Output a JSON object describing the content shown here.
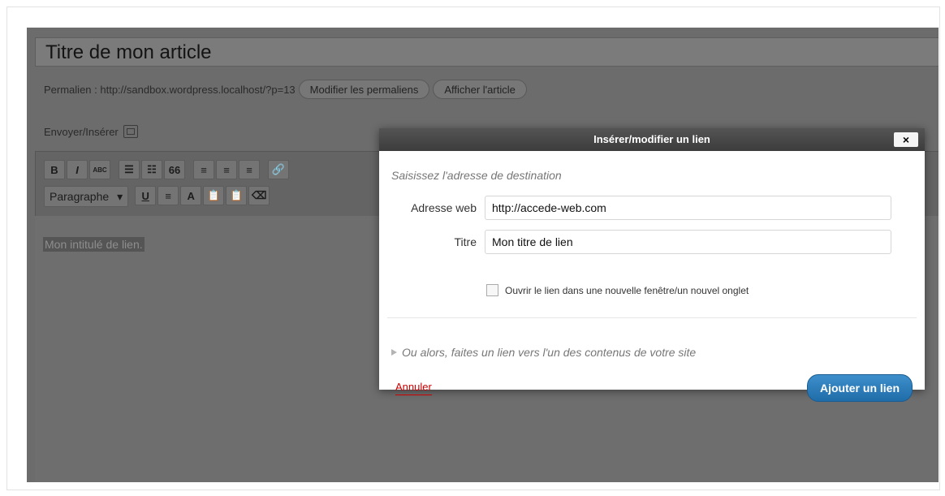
{
  "post": {
    "title": "Titre de mon article",
    "permalink_label": "Permalien : http://sandbox.wordpress.localhost/?p=13",
    "edit_permalink_btn": "Modifier les permaliens",
    "view_post_btn": "Afficher l'article",
    "upload_label": "Envoyer/Insérer",
    "paragraph_select": "Paragraphe",
    "content_selected_text": "Mon intitulé de lien."
  },
  "toolbar": {
    "row1": [
      {
        "name": "bold-icon",
        "glyph": "B"
      },
      {
        "name": "italic-icon",
        "glyph": "I"
      },
      {
        "name": "strikethrough-icon",
        "glyph": "ABC"
      },
      {
        "name": "bullet-list-icon",
        "glyph": "☰"
      },
      {
        "name": "numbered-list-icon",
        "glyph": "☷"
      },
      {
        "name": "blockquote-icon",
        "glyph": "66"
      },
      {
        "name": "align-left-icon",
        "glyph": "≡"
      },
      {
        "name": "align-center-icon",
        "glyph": "≡"
      },
      {
        "name": "align-right-icon",
        "glyph": "≡"
      },
      {
        "name": "link-icon",
        "glyph": "🔗"
      }
    ],
    "row2": [
      {
        "name": "underline-icon",
        "glyph": "U"
      },
      {
        "name": "justify-icon",
        "glyph": "≡"
      },
      {
        "name": "text-color-icon",
        "glyph": "A"
      },
      {
        "name": "paste-text-icon",
        "glyph": "📋"
      },
      {
        "name": "paste-word-icon",
        "glyph": "📋"
      },
      {
        "name": "eraser-icon",
        "glyph": "⌫"
      }
    ]
  },
  "dialog": {
    "title": "Insérer/modifier un lien",
    "close": "×",
    "hint": "Saisissez l'adresse de destination",
    "url_label": "Adresse web",
    "url_value": "http://accede-web.com",
    "title_label": "Titre",
    "title_value": "Mon titre de lien",
    "new_window_label": "Ouvrir le lien dans une nouvelle fenêtre/un nouvel onglet",
    "new_window_checked": false,
    "alt_link": "Ou alors, faites un lien vers l'un des contenus de votre site",
    "cancel": "Annuler",
    "submit": "Ajouter un lien"
  },
  "colors": {
    "overlay": "#6c6c6c",
    "primary_button": "#2a7ab8",
    "cancel_link": "#cc0000"
  }
}
